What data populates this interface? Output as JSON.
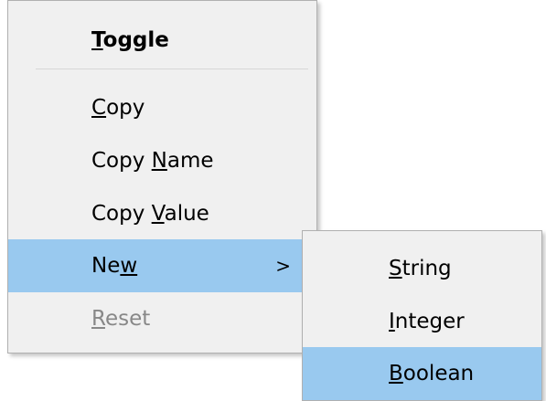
{
  "context_menu": {
    "items": [
      {
        "pre": "",
        "key": "T",
        "post": "oggle"
      },
      {
        "pre": "",
        "key": "C",
        "post": "opy"
      },
      {
        "pre": "Copy ",
        "key": "N",
        "post": "ame"
      },
      {
        "pre": "Copy ",
        "key": "V",
        "post": "alue"
      },
      {
        "pre": "Ne",
        "key": "w",
        "post": "",
        "submenu_arrow": ">"
      },
      {
        "pre": "",
        "key": "R",
        "post": "eset"
      }
    ]
  },
  "new_submenu": {
    "items": [
      {
        "pre": "",
        "key": "S",
        "post": "tring"
      },
      {
        "pre": "",
        "key": "I",
        "post": "nteger"
      },
      {
        "pre": "",
        "key": "B",
        "post": "oolean"
      }
    ]
  },
  "colors": {
    "menu_background": "#f0f0f0",
    "highlight": "#99c9ef",
    "disabled_text": "#888888",
    "separator": "#d7d7d7"
  }
}
